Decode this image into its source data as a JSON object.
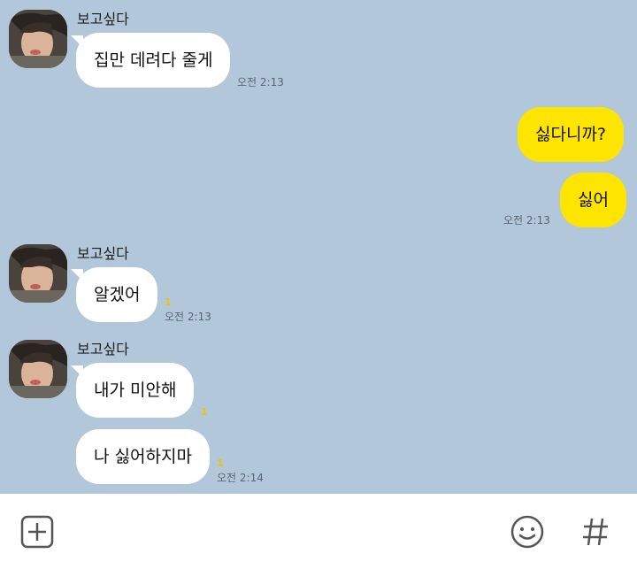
{
  "chat": {
    "sender_name": "보고싶다",
    "messages": [
      {
        "text": "집만 데려다 줄게",
        "time": "오전 2:13"
      },
      {
        "text": "싫다니까?"
      },
      {
        "text": "싫어",
        "time": "오전 2:13"
      },
      {
        "text": "알겠어",
        "time": "오전 2:13",
        "unread": "1"
      },
      {
        "text": "내가 미안해",
        "unread": "1"
      },
      {
        "text": "나 싫어하지마",
        "time": "오전 2:14",
        "unread": "1"
      }
    ]
  },
  "input_bar": {
    "plus_icon": "plus-square-icon",
    "emoji_icon": "smiley-icon",
    "hash_icon": "hash-icon"
  },
  "colors": {
    "background": "#b2c7d9",
    "incoming_bubble": "#ffffff",
    "outgoing_bubble": "#fee500",
    "unread": "#f0c400"
  }
}
